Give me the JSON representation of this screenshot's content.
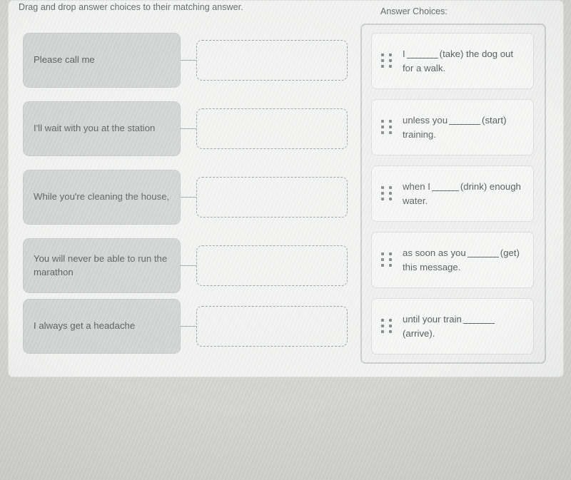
{
  "instruction": "Drag and drop answer choices to their matching answer.",
  "answer_choices_label": "Answer Choices:",
  "prompts": [
    {
      "text": "Please call me"
    },
    {
      "text": "I'll wait with you at the station"
    },
    {
      "text": "While you're cleaning the house,"
    },
    {
      "text": "You will never be able to run the marathon"
    },
    {
      "text": "I always get a headache"
    }
  ],
  "drop_zones": [
    {
      "value": ""
    },
    {
      "value": ""
    },
    {
      "value": ""
    },
    {
      "value": ""
    },
    {
      "value": ""
    }
  ],
  "choices": [
    {
      "before": "I",
      "after": "(take) the dog out for a walk."
    },
    {
      "before": "unless you",
      "after": "(start) training."
    },
    {
      "before": "when I",
      "after": "(drink) enough water."
    },
    {
      "before": "as soon as you",
      "after": "(get) this message."
    },
    {
      "before": "until your train",
      "after": "(arrive)."
    }
  ],
  "icons": {
    "drag_handle": "drag-handle-dots-icon"
  },
  "colors": {
    "page_background": "#cfcfcb",
    "card_background": "#f2f3f1",
    "prompt_fill": "#cdcfcd",
    "choice_fill": "#f7f8f6",
    "text": "#43484a",
    "dashed_border": "#8d9494",
    "panel_border": "#c6c8c6"
  }
}
